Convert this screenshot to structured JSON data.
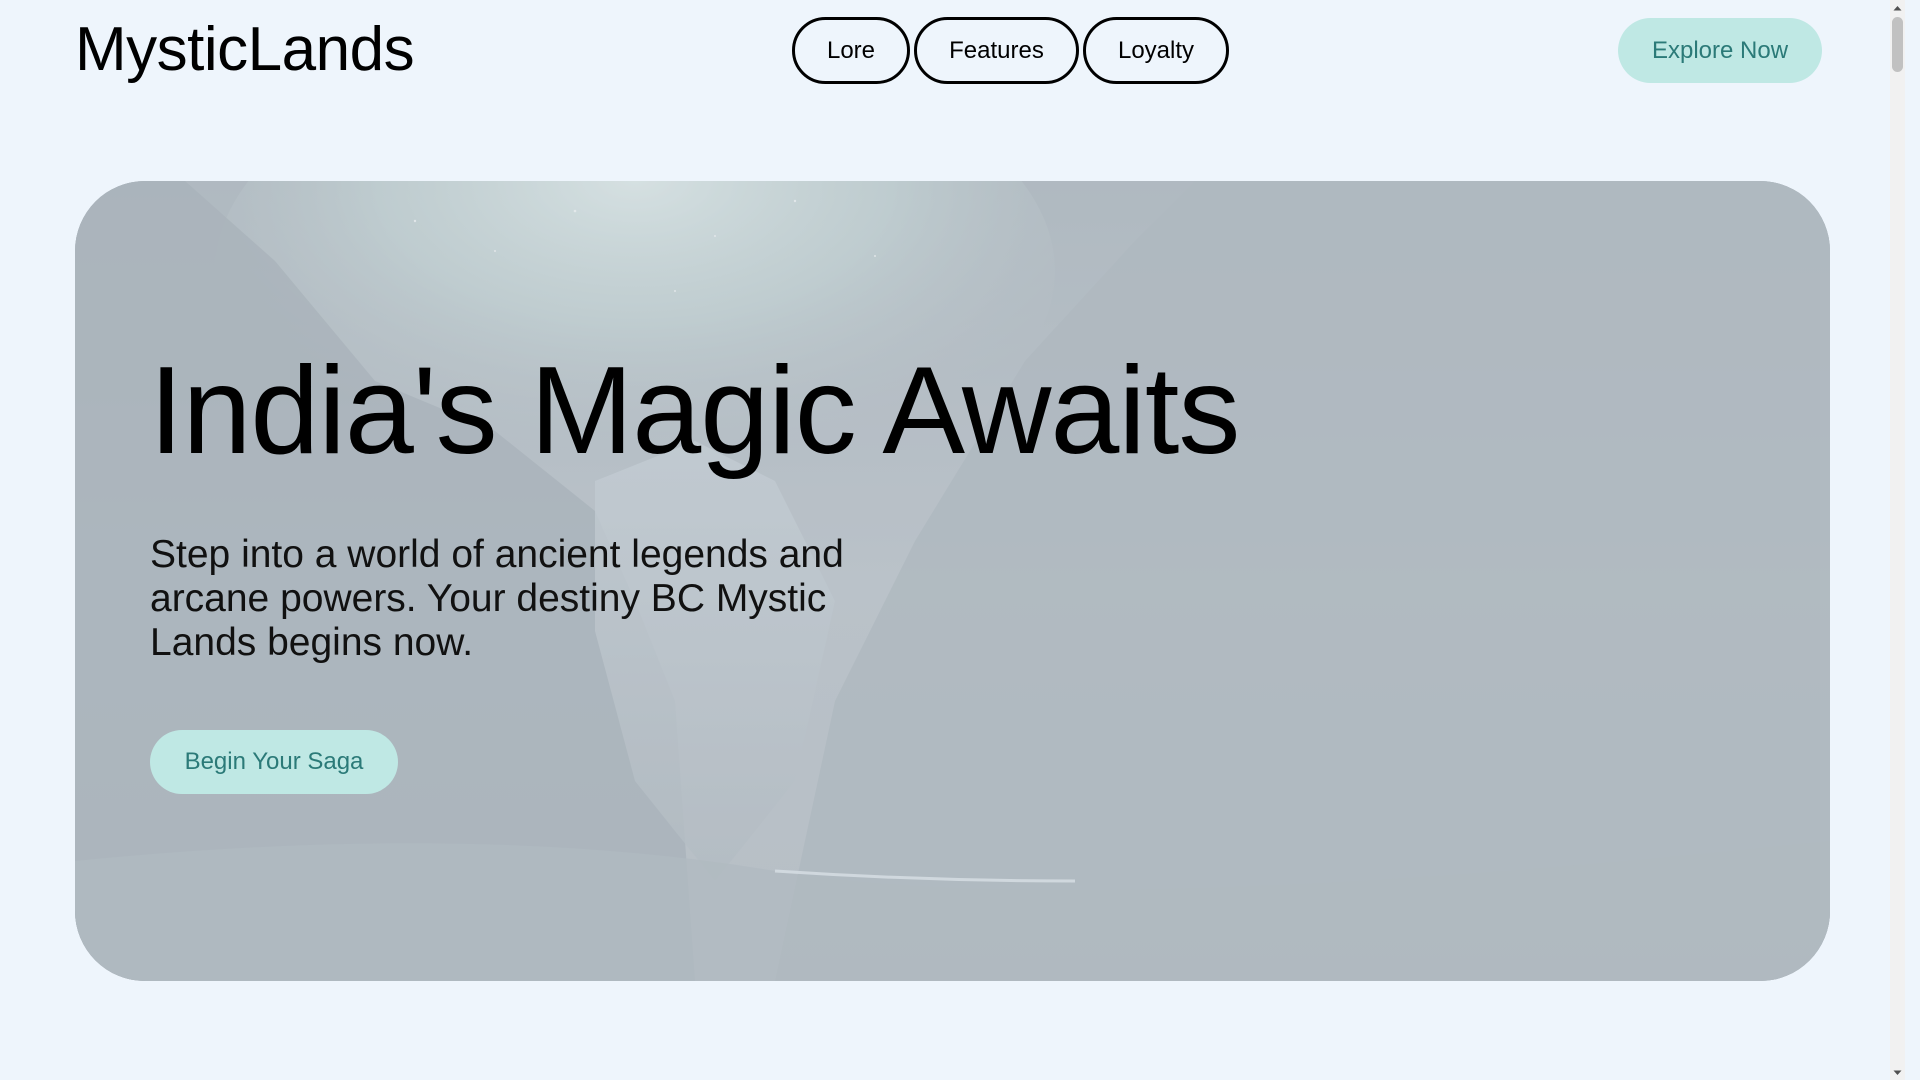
{
  "brand": {
    "logo_text": "MysticLands"
  },
  "nav": {
    "items": [
      {
        "label": "Lore"
      },
      {
        "label": "Features"
      },
      {
        "label": "Loyalty"
      }
    ]
  },
  "header": {
    "cta_label": "Explore Now"
  },
  "hero": {
    "title": "India's Magic Awaits",
    "subtitle": "Step into a world of ancient legends and arcane powers. Your destiny BC Mystic Lands begins now.",
    "cta_label": "Begin Your Saga",
    "background_image": "misty-mountain-valley-aurora"
  },
  "colors": {
    "page_background": "#eef5fc",
    "accent_button_bg": "#bfe8e4",
    "accent_button_text": "#2b7a78",
    "text": "#000000"
  },
  "icons": {
    "scroll_up": "chevron-up-icon",
    "scroll_down": "chevron-down-icon"
  }
}
